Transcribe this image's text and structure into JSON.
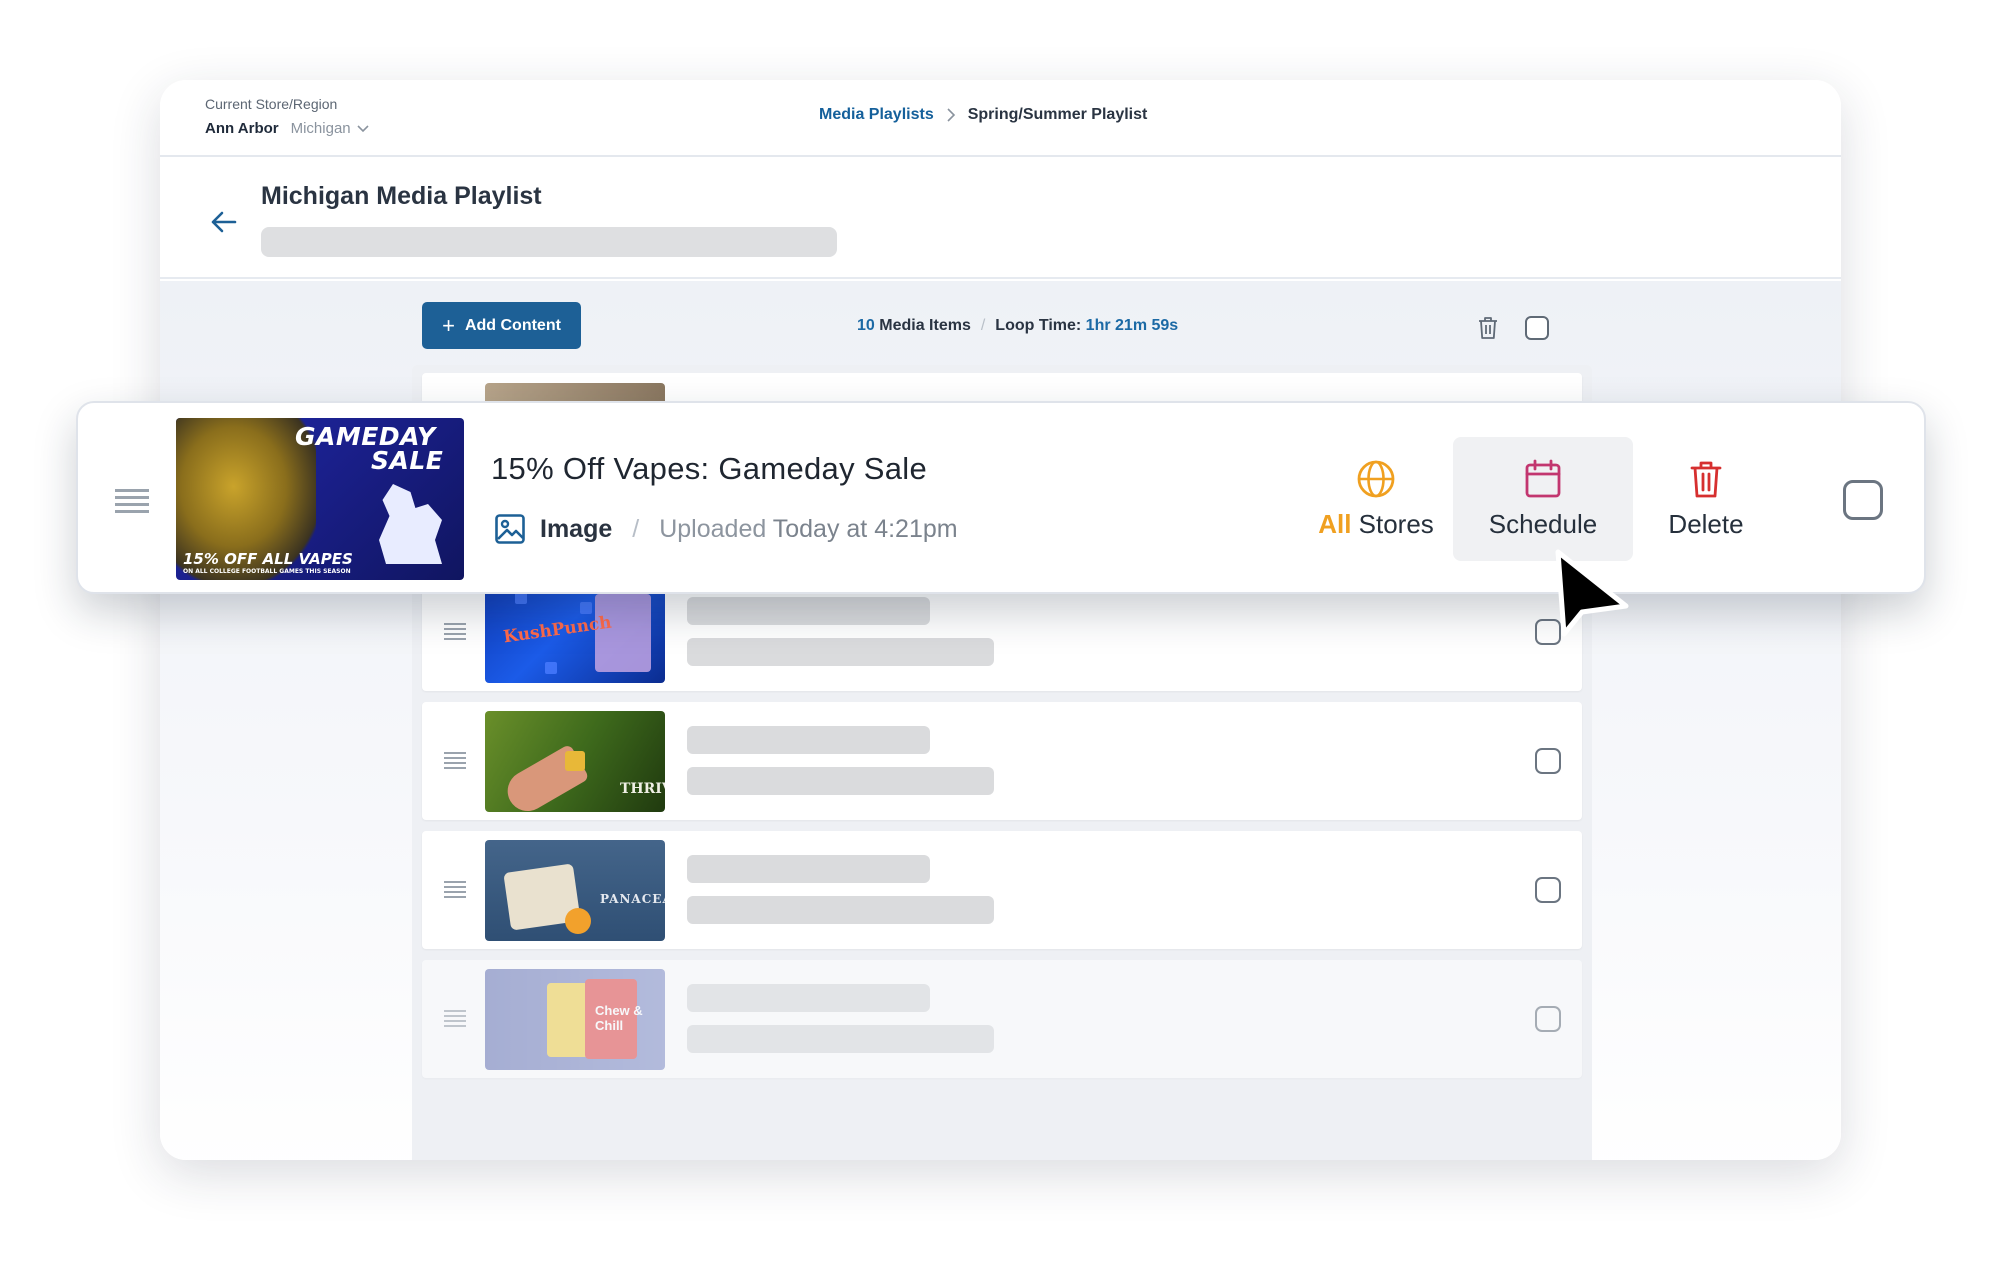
{
  "header": {
    "store_label": "Current Store/Region",
    "store_city": "Ann Arbor",
    "store_region": "Michigan",
    "breadcrumb": {
      "parent": "Media Playlists",
      "current": "Spring/Summer Playlist"
    }
  },
  "page": {
    "title": "Michigan Media Playlist"
  },
  "toolbar": {
    "add_content_label": "Add Content",
    "media_count": "10",
    "media_items_label": "Media Items",
    "loop_time_label": "Loop Time:",
    "loop_time_value": "1hr 21m 59s"
  },
  "featured_item": {
    "thumbnail_text": {
      "line1": "GAMEDAY",
      "line2": "SALE",
      "line3": "15% OFF ALL VAPES",
      "line4": "ON ALL COLLEGE FOOTBALL GAMES THIS SEASON"
    },
    "title": "15% Off Vapes: Gameday Sale",
    "type": "Image",
    "uploaded_label": "Uploaded",
    "uploaded_value": "Today at 4:21pm",
    "actions": {
      "stores_prefix": "All",
      "stores_label": "Stores",
      "schedule_label": "Schedule",
      "delete_label": "Delete"
    }
  },
  "list_thumbnails": {
    "kush_text": "KushPunch",
    "thrive_text": "THRIVE",
    "panacea_text": "PANACEA",
    "chew_text": "Chew & Chill"
  },
  "colors": {
    "primary": "#1d6096",
    "link": "#15609b",
    "accent_orange": "#f0a020",
    "schedule_icon": "#c2366f",
    "delete_icon": "#d62f2f"
  },
  "icons": [
    "back-arrow-icon",
    "chevron-down-icon",
    "plus-icon",
    "trash-icon",
    "drag-handle-icon",
    "image-icon",
    "globe-icon",
    "calendar-icon",
    "cursor-icon"
  ]
}
